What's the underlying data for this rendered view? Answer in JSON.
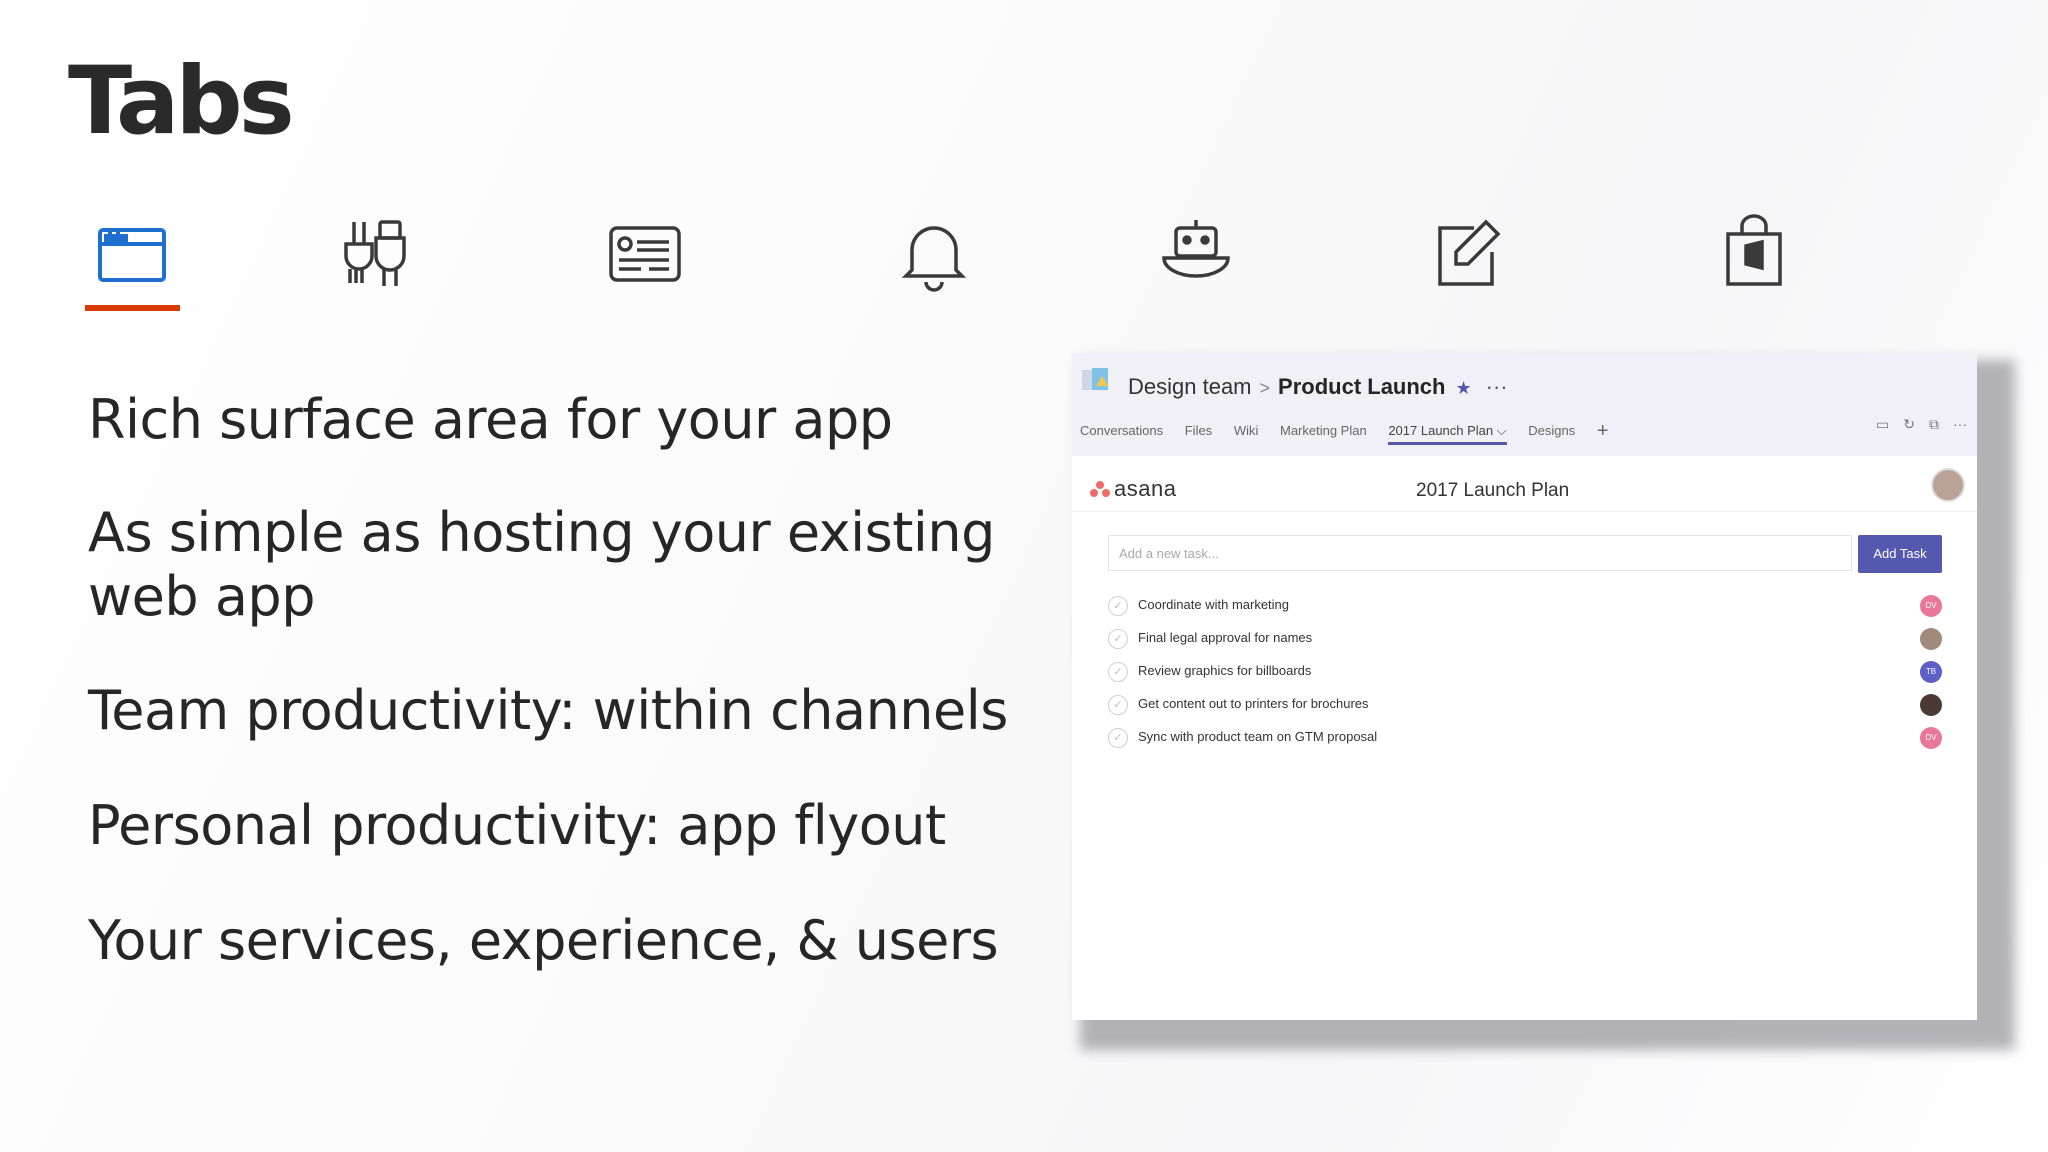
{
  "slide": {
    "title": "Tabs",
    "icons": [
      {
        "name": "tab-icon",
        "active": true
      },
      {
        "name": "connector-icon",
        "active": false
      },
      {
        "name": "card-icon",
        "active": false
      },
      {
        "name": "notification-bell-icon",
        "active": false
      },
      {
        "name": "bot-icon",
        "active": false
      },
      {
        "name": "compose-extension-icon",
        "active": false
      },
      {
        "name": "office-store-icon",
        "active": false
      }
    ],
    "bullets": [
      "Rich surface area for your app",
      "As simple as hosting your existing web app",
      "Team productivity: within channels",
      "Personal productivity: app flyout",
      "Your services, experience, & users"
    ],
    "accent_color": "#d83b01"
  },
  "screenshot": {
    "breadcrumb": {
      "team": "Design team",
      "separator": ">",
      "channel": "Product Launch",
      "favorite": "★",
      "more": "···"
    },
    "tabs": [
      "Conversations",
      "Files",
      "Wiki",
      "Marketing Plan",
      "2017 Launch Plan",
      "Designs"
    ],
    "active_tab": "2017 Launch Plan",
    "active_tab_label": "2017 Launch Plan ⌵",
    "add_tab": "+",
    "header_actions": [
      "chat-icon",
      "refresh-icon",
      "popout-icon",
      "more-icon"
    ],
    "asana": {
      "logo_text": "asana",
      "plan_title": "2017 Launch Plan",
      "task_placeholder": "Add a new task...",
      "add_task_label": "Add Task",
      "tasks": [
        {
          "label": "Coordinate with marketing",
          "assignee_initials": "DV",
          "assignee_color": "#e8779a"
        },
        {
          "label": "Final legal approval for names",
          "assignee_initials": "",
          "assignee_color": "#a08a7c"
        },
        {
          "label": "Review graphics for billboards",
          "assignee_initials": "TB",
          "assignee_color": "#5b5fc7"
        },
        {
          "label": "Get content out to printers for brochures",
          "assignee_initials": "",
          "assignee_color": "#4a3a33"
        },
        {
          "label": "Sync with product team on GTM proposal",
          "assignee_initials": "DV",
          "assignee_color": "#e8779a"
        }
      ]
    },
    "brand_color": "#5558af"
  }
}
